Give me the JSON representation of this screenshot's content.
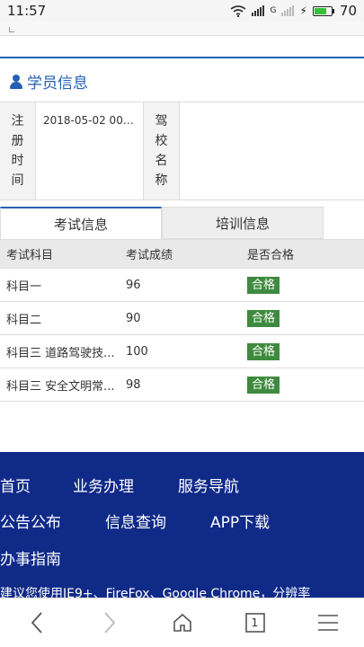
{
  "status_bar": {
    "time": "11:57",
    "network_label": "G",
    "battery": "70"
  },
  "section": {
    "title": "学员信息"
  },
  "student_info": {
    "reg_time_label": "注册时间",
    "reg_time_value": "2018-05-02 00:...",
    "school_label": "驾校名称",
    "school_value": ""
  },
  "tabs": [
    {
      "label": "考试信息",
      "active": true
    },
    {
      "label": "培训信息",
      "active": false
    }
  ],
  "results": {
    "headers": [
      "考试科目",
      "考试成绩",
      "是否合格"
    ],
    "rows": [
      {
        "subject": "科目一",
        "score": "96",
        "result": "合格"
      },
      {
        "subject": "科目二",
        "score": "90",
        "result": "合格"
      },
      {
        "subject": "科目三 道路驾驶技...",
        "score": "100",
        "result": "合格"
      },
      {
        "subject": "科目三 安全文明常...",
        "score": "98",
        "result": "合格"
      }
    ]
  },
  "footer": {
    "links_row1": [
      "首页",
      "业务办理",
      "服务导航"
    ],
    "links_row2": [
      "公告公布",
      "信息查询",
      "APP下载"
    ],
    "links_row3": [
      "办事指南"
    ],
    "note": "建议您使用IE9+、FireFox、Google Chrome，分辨率"
  },
  "browser_nav": {
    "tab_count": "1"
  },
  "colors": {
    "accent": "#2560b3",
    "footer_bg": "#102a88",
    "pass_badge": "#3e8a3e"
  }
}
